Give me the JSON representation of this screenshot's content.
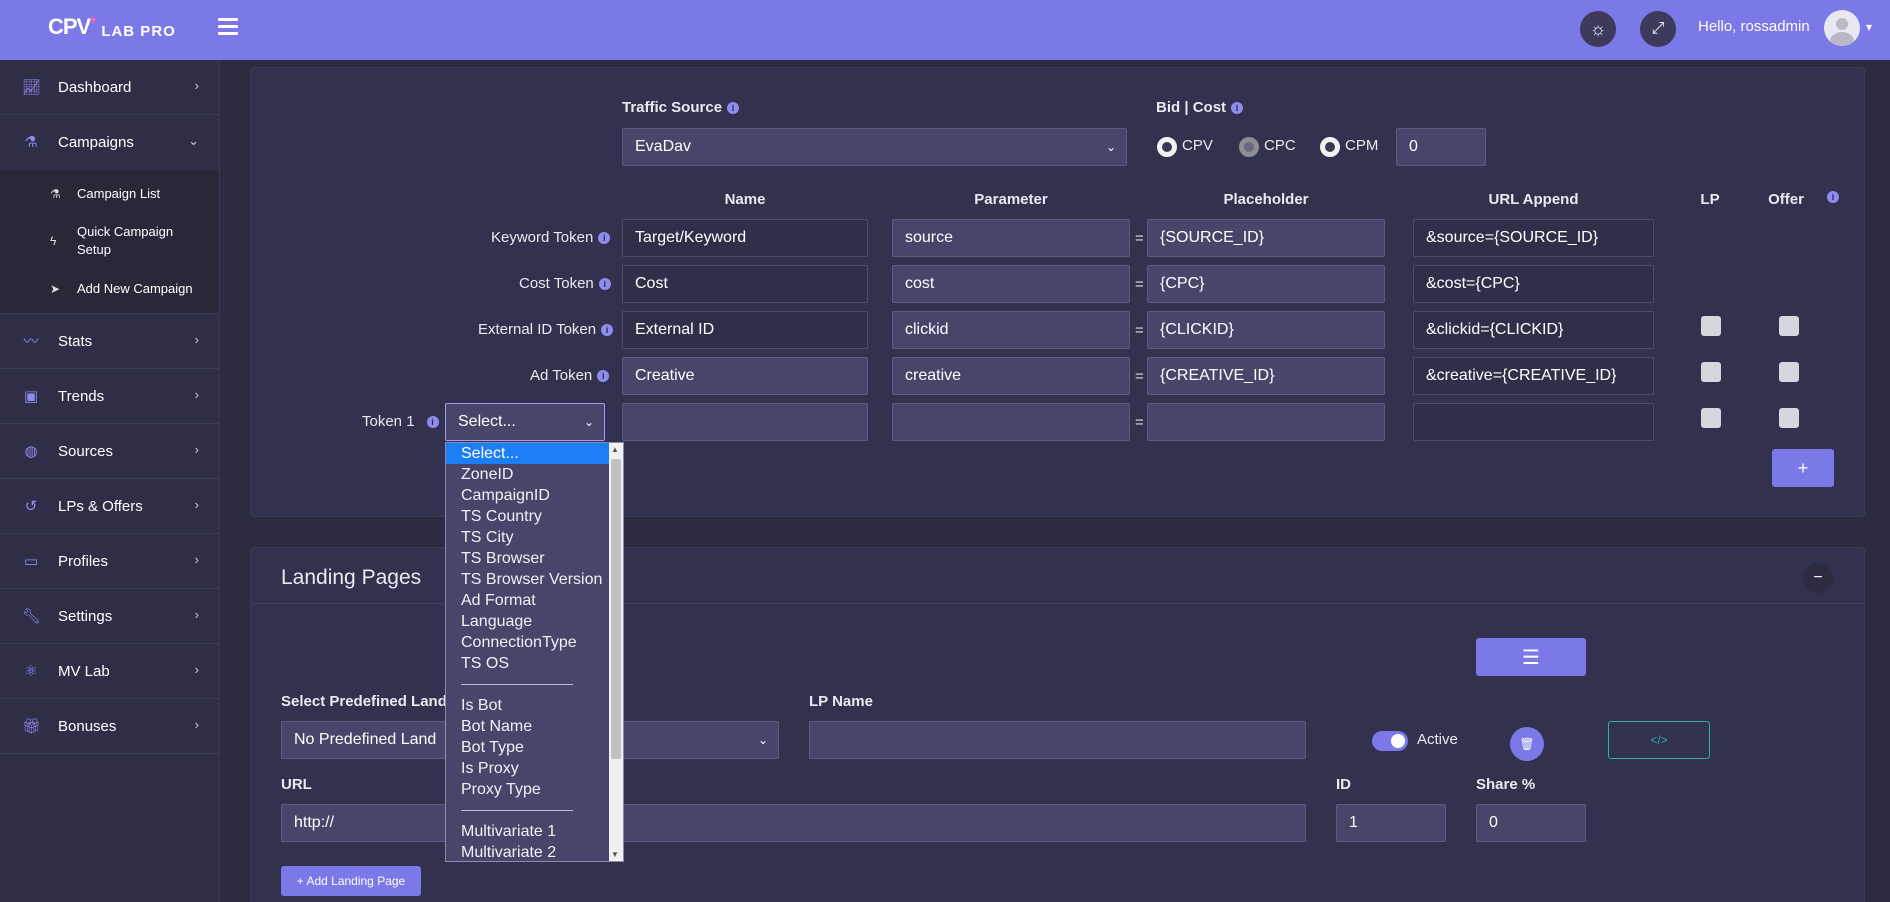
{
  "app": {
    "logo_main": "CPV",
    "logo_sub": "LAB PRO",
    "greeting": "Hello, rossadmin"
  },
  "icons": {
    "theme": "sun-icon",
    "fullscreen": "expand-icon",
    "menu": "hamburger-icon",
    "user": "user-avatar-icon"
  },
  "colors": {
    "accent": "#7b78e8",
    "topbar": "#7b78e8",
    "sidebar": "#2f2e46",
    "background": "#2c2b42",
    "card": "#33324e",
    "select_highlight": "#1c7ef5"
  },
  "sidebar": {
    "items": [
      {
        "label": "Dashboard",
        "icon": "chart-line-icon"
      },
      {
        "label": "Campaigns",
        "icon": "flask-icon"
      },
      {
        "label": "Stats",
        "icon": "stats-icon"
      },
      {
        "label": "Trends",
        "icon": "briefcase-icon"
      },
      {
        "label": "Sources",
        "icon": "globe-icon"
      },
      {
        "label": "LPs & Offers",
        "icon": "history-icon"
      },
      {
        "label": "Profiles",
        "icon": "clipboard-icon"
      },
      {
        "label": "Settings",
        "icon": "wrench-icon"
      },
      {
        "label": "MV Lab",
        "icon": "atom-icon"
      },
      {
        "label": "Bonuses",
        "icon": "gift-icon"
      }
    ],
    "campaign_sub": [
      {
        "label": "Campaign List",
        "icon": "flask-icon"
      },
      {
        "label": "Quick Campaign Setup",
        "icon": "bolt-icon"
      },
      {
        "label": "Add New Campaign",
        "icon": "paper-plane-icon"
      }
    ]
  },
  "traffic": {
    "label": "Traffic Source",
    "value": "EvaDav",
    "bid_label": "Bid | Cost",
    "bid_options": [
      "CPV",
      "CPC",
      "CPM"
    ],
    "bid_selected": "CPC",
    "bid_value": "0"
  },
  "tokens": {
    "headers": {
      "name": "Name",
      "parameter": "Parameter",
      "placeholder": "Placeholder",
      "url_append": "URL Append",
      "lp": "LP",
      "offer": "Offer"
    },
    "rows": [
      {
        "label": "Keyword Token",
        "name": "Target/Keyword",
        "parameter": "source",
        "placeholder": "{SOURCE_ID}",
        "url_append": "&source={SOURCE_ID}"
      },
      {
        "label": "Cost Token",
        "name": "Cost",
        "parameter": "cost",
        "placeholder": "{CPC}",
        "url_append": "&cost={CPC}"
      },
      {
        "label": "External ID Token",
        "name": "External ID",
        "parameter": "clickid",
        "placeholder": "{CLICKID}",
        "url_append": "&clickid={CLICKID}"
      },
      {
        "label": "Ad Token",
        "name": "Creative",
        "parameter": "creative",
        "placeholder": "{CREATIVE_ID}",
        "url_append": "&creative={CREATIVE_ID}"
      },
      {
        "label": "Token 1",
        "select": "Select...",
        "name": "",
        "parameter": "",
        "placeholder": "",
        "url_append": ""
      }
    ],
    "add_button": "+"
  },
  "dropdown": {
    "options": [
      "Select...",
      "ZoneID",
      "CampaignID",
      "TS Country",
      "TS City",
      "TS Browser",
      "TS Browser Version",
      "Ad Format",
      "Language",
      "ConnectionType",
      "TS OS",
      "---",
      "Is Bot",
      "Bot Name",
      "Bot Type",
      "Is Proxy",
      "Proxy Type",
      "---",
      "Multivariate 1",
      "Multivariate 2"
    ],
    "selected": "Select..."
  },
  "landing": {
    "title": "Landing Pages",
    "collapse": "−",
    "predefined_label": "Select Predefined Landi",
    "predefined_value": "No Predefined Land",
    "lp_name_label": "LP Name",
    "lp_name_value": "",
    "active_label": "Active",
    "url_label": "URL",
    "url_value": "http://",
    "id_label": "ID",
    "id_value": "1",
    "share_label": "Share %",
    "share_value": "0",
    "add_button": "+ Add Landing Page",
    "code_button": "</>"
  }
}
